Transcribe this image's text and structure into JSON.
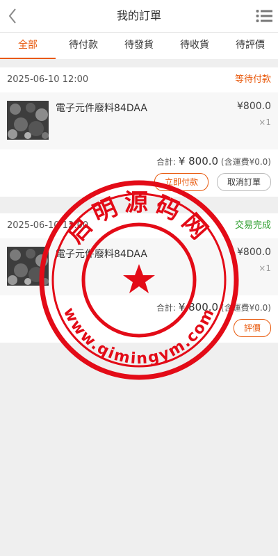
{
  "header": {
    "title": "我的訂單",
    "back_icon": "chevron-left-icon",
    "menu_icon": "list-menu-icon"
  },
  "tabs": [
    {
      "label": "全部",
      "active": true
    },
    {
      "label": "待付款",
      "active": false
    },
    {
      "label": "待發貨",
      "active": false
    },
    {
      "label": "待收貨",
      "active": false
    },
    {
      "label": "待評價",
      "active": false
    }
  ],
  "orders": [
    {
      "date": "2025-06-10 12:00",
      "status": "等待付款",
      "status_color": "#e8590c",
      "item": {
        "name": "電子元件廢料84DAA",
        "price": "¥800.0",
        "qty": "×1"
      },
      "summary_label": "合計:",
      "summary_amount": "¥ 800.0",
      "summary_note": "(含運費¥0.0)",
      "actions": [
        "立即付款",
        "取消訂單"
      ]
    },
    {
      "date": "2025-06-10 12:00",
      "status": "交易完成",
      "status_color": "#2e9e2e",
      "item": {
        "name": "電子元件廢料84DAA",
        "price": "¥800.0",
        "qty": "×1"
      },
      "summary_label": "合計:",
      "summary_amount": "¥ 800.0",
      "summary_note": "(含運費¥0.0)",
      "actions": [
        "評價"
      ]
    }
  ],
  "watermark": {
    "top_text": "启明源码网",
    "bottom_text": "www.qimingym.com",
    "color": "#e30b17"
  },
  "colors": {
    "accent": "#e8590c",
    "success": "#2e9e2e"
  }
}
